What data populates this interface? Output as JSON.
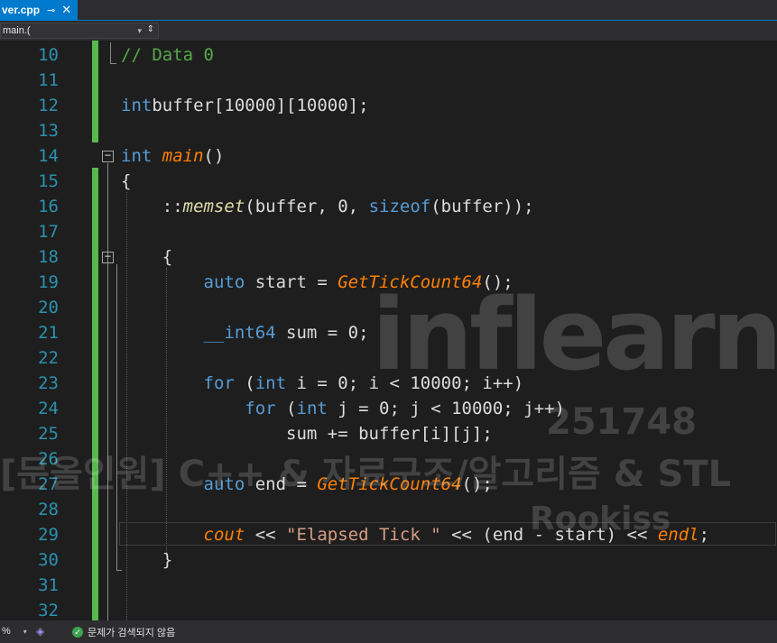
{
  "tab": {
    "filename": "ver.cpp",
    "pin_glyph": "⊸",
    "close_glyph": "✕"
  },
  "navbar": {
    "scope_value": "main.(",
    "dropdown_glyph": "▾",
    "splitter_glyph": "⇕"
  },
  "lines": [
    {
      "n": "10",
      "tokens": [
        [
          "cm",
          "// Data 0"
        ]
      ]
    },
    {
      "n": "11",
      "tokens": []
    },
    {
      "n": "12",
      "tokens": [
        [
          "kw",
          "int"
        ],
        [
          "",
          "buffer[10000][10000];"
        ]
      ]
    },
    {
      "n": "13",
      "tokens": []
    },
    {
      "n": "14",
      "tokens": [
        [
          "kw",
          "int"
        ],
        [
          "",
          " "
        ],
        [
          "fn",
          "main"
        ],
        [
          "",
          "()"
        ]
      ]
    },
    {
      "n": "15",
      "tokens": [
        [
          "",
          "{"
        ]
      ]
    },
    {
      "n": "16",
      "tokens": [
        [
          "",
          "    ::"
        ],
        [
          "fn2",
          "memset"
        ],
        [
          "",
          "(buffer, 0, "
        ],
        [
          "kw",
          "sizeof"
        ],
        [
          "",
          "(buffer));"
        ]
      ]
    },
    {
      "n": "17",
      "tokens": []
    },
    {
      "n": "18",
      "tokens": [
        [
          "",
          "    {"
        ]
      ]
    },
    {
      "n": "19",
      "tokens": [
        [
          "",
          "        "
        ],
        [
          "kw",
          "auto"
        ],
        [
          "",
          " start = "
        ],
        [
          "fn",
          "GetTickCount64"
        ],
        [
          "",
          "();"
        ]
      ]
    },
    {
      "n": "20",
      "tokens": []
    },
    {
      "n": "21",
      "tokens": [
        [
          "",
          "        "
        ],
        [
          "kw",
          "__int64"
        ],
        [
          "",
          " sum = 0;"
        ]
      ]
    },
    {
      "n": "22",
      "tokens": []
    },
    {
      "n": "23",
      "tokens": [
        [
          "",
          "        "
        ],
        [
          "kw",
          "for"
        ],
        [
          "",
          " ("
        ],
        [
          "kw",
          "int"
        ],
        [
          "",
          " i = 0; i < 10000; i++)"
        ]
      ]
    },
    {
      "n": "24",
      "tokens": [
        [
          "",
          "            "
        ],
        [
          "kw",
          "for"
        ],
        [
          "",
          " ("
        ],
        [
          "kw",
          "int"
        ],
        [
          "",
          " j = 0; j < 10000; j++)"
        ]
      ]
    },
    {
      "n": "25",
      "tokens": [
        [
          "",
          "                sum += buffer[i][j];"
        ]
      ]
    },
    {
      "n": "26",
      "tokens": []
    },
    {
      "n": "27",
      "tokens": [
        [
          "",
          "        "
        ],
        [
          "kw",
          "auto"
        ],
        [
          "",
          " end = "
        ],
        [
          "fn",
          "GetTickCount64"
        ],
        [
          "",
          "();"
        ]
      ]
    },
    {
      "n": "28",
      "tokens": []
    },
    {
      "n": "29",
      "tokens": [
        [
          "",
          "        "
        ],
        [
          "fn",
          "cout"
        ],
        [
          "",
          " << "
        ],
        [
          "st",
          "\"Elapsed Tick \""
        ],
        [
          "",
          " << (end - start) << "
        ],
        [
          "fn",
          "endl"
        ],
        [
          "",
          ";"
        ]
      ]
    },
    {
      "n": "30",
      "tokens": [
        [
          "",
          "    }"
        ]
      ]
    },
    {
      "n": "31",
      "tokens": []
    },
    {
      "n": "32",
      "tokens": []
    }
  ],
  "watermark": {
    "brand": "inflearn",
    "id": "251748",
    "course": "[문올인원] C++ & 자료구조/알고리즘 & STL",
    "author": "Rookiss"
  },
  "statusbar": {
    "zoom": "%",
    "zoom_dropdown": "▾",
    "issues_text": "문제가 검색되지 않음",
    "ok_glyph": "✓"
  },
  "colors": {
    "accent": "#007acc",
    "change_bar": "#57b94d",
    "line_number": "#2b91af",
    "keyword": "#569cd6",
    "comment": "#57a64a",
    "function": "#ff8000"
  }
}
